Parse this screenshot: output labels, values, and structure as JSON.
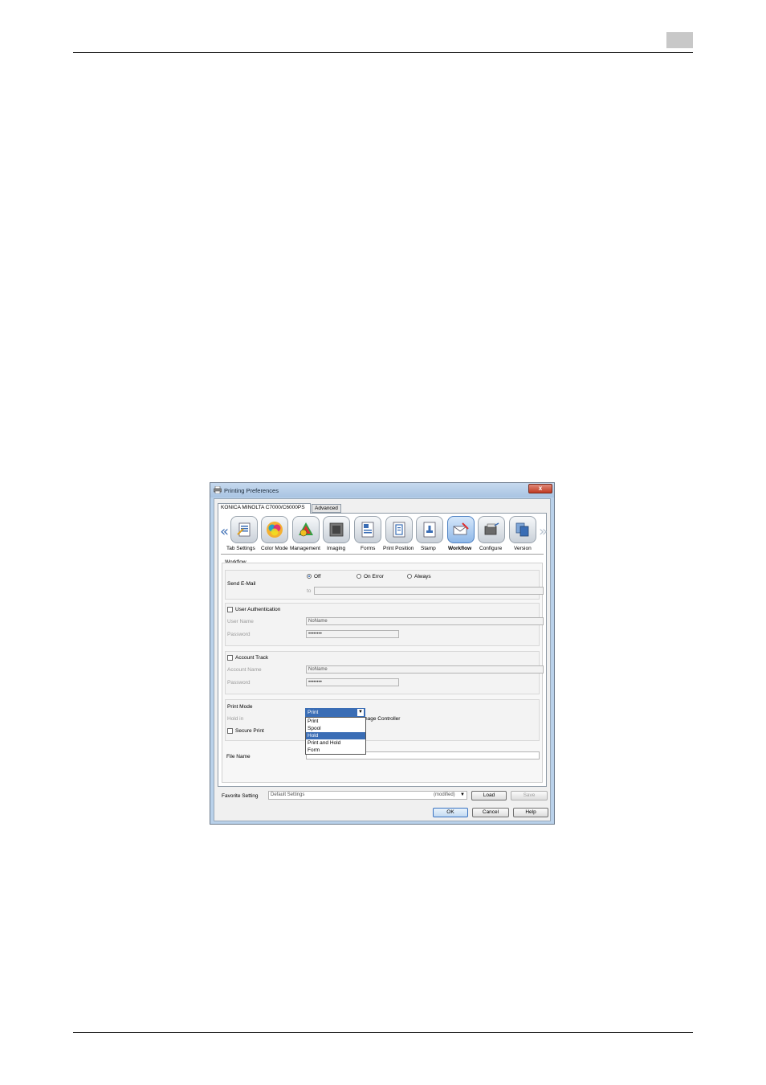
{
  "window": {
    "title": "Printing Preferences",
    "close_glyph": "x"
  },
  "tabs": [
    {
      "label": "KONICA MINOLTA C7000/C6000PS",
      "active": true
    },
    {
      "label": "Advanced",
      "active": false
    }
  ],
  "toolbar": {
    "prev_glyph": "«",
    "next_glyph": "»",
    "items": [
      {
        "label": "Tab Settings",
        "icon": "tab-settings-icon"
      },
      {
        "label": "Color Mode",
        "icon": "color-mode-icon"
      },
      {
        "label": "Management",
        "icon": "color-management-icon"
      },
      {
        "label": "Imaging",
        "icon": "imaging-icon"
      },
      {
        "label": "Forms",
        "icon": "forms-icon"
      },
      {
        "label": "Print Position",
        "icon": "print-position-icon"
      },
      {
        "label": "Stamp",
        "icon": "stamp-icon"
      },
      {
        "label": "Workflow",
        "icon": "workflow-icon",
        "selected": true
      },
      {
        "label": "Configure",
        "icon": "configure-icon"
      },
      {
        "label": "Version",
        "icon": "version-icon"
      }
    ]
  },
  "workflow": {
    "group_title": "Workflow",
    "send_email": {
      "label": "Send E-Mail",
      "options": [
        "Off",
        "On Error",
        "Always"
      ],
      "selected": "Off",
      "to_label": "to",
      "to_value": ""
    },
    "user_auth": {
      "checkbox_label": "User Authentication",
      "user_name_label": "User Name",
      "user_name_value": "NoName",
      "password_label": "Password",
      "password_value": "••••••••"
    },
    "account_track": {
      "checkbox_label": "Account Track",
      "account_name_label": "Account Name",
      "account_name_value": "NoName",
      "password_label": "Password",
      "password_value": "••••••••"
    },
    "print_mode": {
      "label": "Print Mode",
      "value": "Print",
      "options": [
        "Print",
        "Spool",
        "Hold",
        "Print and Hold",
        "Form"
      ],
      "highlighted": "Hold",
      "hold_in_label": "Hold in",
      "hold_in_value_partial": "nage Controller",
      "secure_print_label": "Secure Print"
    },
    "file_name": {
      "label": "File Name",
      "value": ""
    }
  },
  "favorite": {
    "label": "Favorite Setting",
    "value": "Default Settings",
    "modified": "(modified)",
    "load": "Load",
    "save": "Save"
  },
  "dialog_buttons": {
    "ok": "OK",
    "cancel": "Cancel",
    "help": "Help"
  },
  "colors": {
    "selection": "#3a6db5",
    "window_frame": "#b9d1ea",
    "close": "#c03a22"
  }
}
